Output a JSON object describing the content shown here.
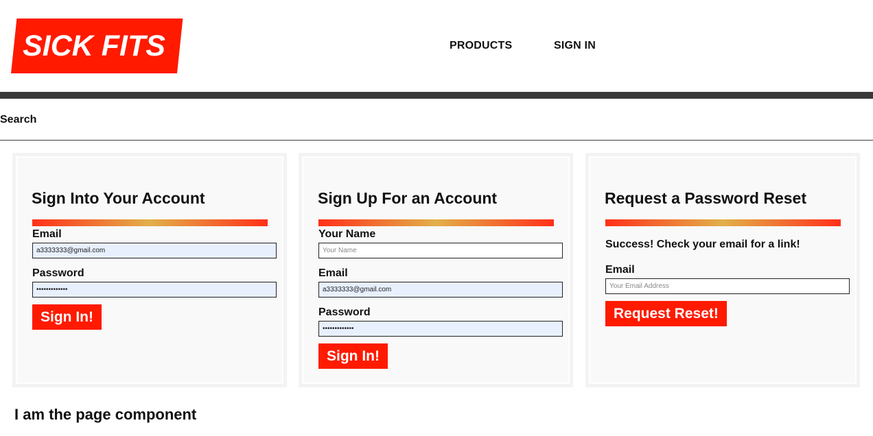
{
  "brand": {
    "logo_text": "SICK FITS",
    "accent_color": "#ff1a00"
  },
  "nav": {
    "products": "PRODUCTS",
    "sign_in": "SIGN IN"
  },
  "search": {
    "label": "Search"
  },
  "signin": {
    "title": "Sign Into Your Account",
    "email_label": "Email",
    "email_value": "a3333333@gmail.com",
    "password_label": "Password",
    "password_value": "•••••••••••••",
    "button": "Sign In!"
  },
  "signup": {
    "title": "Sign Up For an Account",
    "name_label": "Your Name",
    "name_placeholder": "Your Name",
    "email_label": "Email",
    "email_value": "a3333333@gmail.com",
    "password_label": "Password",
    "password_value": "•••••••••••••",
    "button": "Sign In!"
  },
  "reset": {
    "title": "Request a Password Reset",
    "success": "Success! Check your email for a link!",
    "email_label": "Email",
    "email_placeholder": "Your Email Address",
    "button": "Request Reset!"
  },
  "page_component_text": "I am the page component"
}
